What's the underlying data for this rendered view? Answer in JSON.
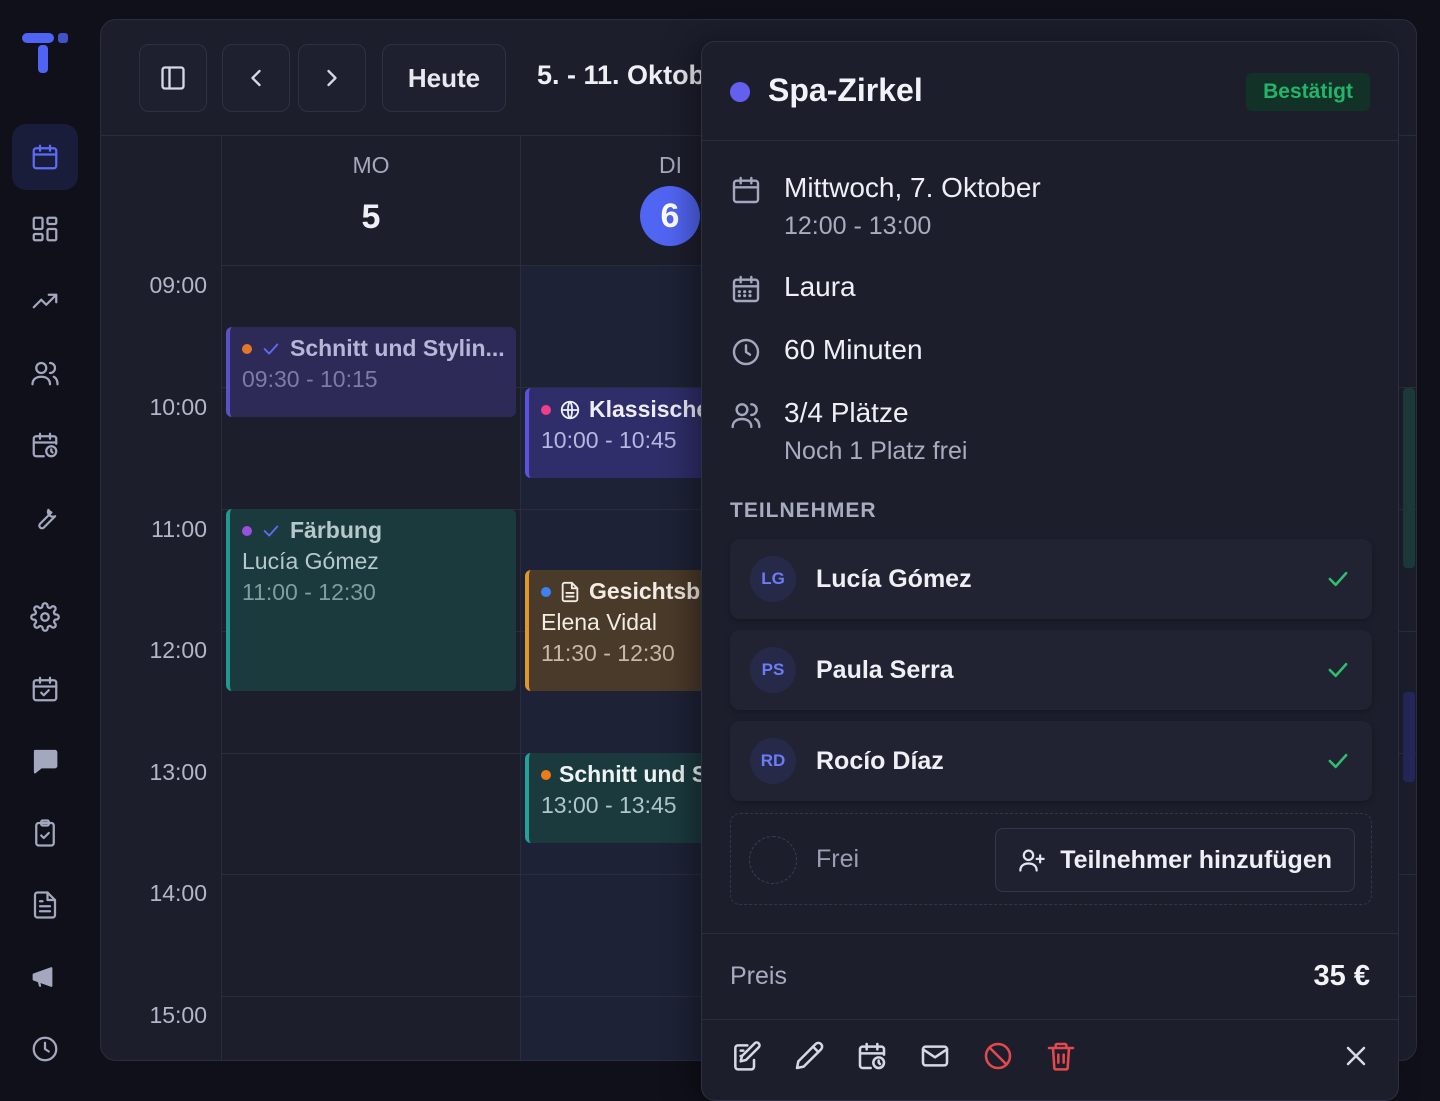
{
  "sidebar": {
    "items": [
      {
        "icon": "calendar-icon",
        "active": true
      },
      {
        "icon": "dashboard-icon"
      },
      {
        "icon": "trending-up-icon"
      },
      {
        "icon": "users-icon"
      },
      {
        "icon": "calendar-clock-icon"
      },
      {
        "icon": "wrench-icon"
      },
      {
        "icon": "gear-icon"
      },
      {
        "icon": "calendar-check-icon"
      },
      {
        "icon": "chat-icon"
      },
      {
        "icon": "clipboard-check-icon"
      },
      {
        "icon": "document-icon"
      },
      {
        "icon": "megaphone-icon"
      },
      {
        "icon": "clock-icon"
      }
    ]
  },
  "toolbar": {
    "today_label": "Heute",
    "range_label": "5. - 11. Oktob"
  },
  "days": [
    {
      "name": "MO",
      "number": "5"
    },
    {
      "name": "DI",
      "number": "6",
      "today": true
    }
  ],
  "times": [
    "09:00",
    "10:00",
    "11:00",
    "12:00",
    "13:00",
    "14:00",
    "15:00"
  ],
  "events": {
    "mon_1": {
      "title": "Schnitt und Stylin...",
      "time": "09:30 - 10:15"
    },
    "mon_2": {
      "title": "Färbung",
      "client": "Lucía Gómez",
      "time": "11:00 - 12:30"
    },
    "tue_1": {
      "title": "Klassische",
      "time": "10:00 - 10:45"
    },
    "tue_2": {
      "title": "Gesichtsbe",
      "client": "Elena Vidal",
      "time": "11:30 - 12:30"
    },
    "tue_3": {
      "title": "Schnitt und S",
      "time": "13:00 - 13:45"
    }
  },
  "panel": {
    "title": "Spa-Zirkel",
    "status": "Bestätigt",
    "date": "Mittwoch, 7. Oktober",
    "time": "12:00 - 13:00",
    "staff": "Laura",
    "duration": "60 Minuten",
    "capacity": "3/4 Plätze",
    "capacity_note": "Noch 1 Platz frei",
    "participants_header": "TEILNEHMER",
    "participants": [
      {
        "initials": "LG",
        "name": "Lucía Gómez"
      },
      {
        "initials": "PS",
        "name": "Paula Serra"
      },
      {
        "initials": "RD",
        "name": "Rocío Díaz"
      }
    ],
    "free_label": "Frei",
    "add_participant_label": "Teilnehmer hinzufügen",
    "price_label": "Preis",
    "price_value": "35 €"
  },
  "colors": {
    "accent": "#5165f3",
    "confirmed": "#22b46b",
    "danger": "#e5484d"
  }
}
